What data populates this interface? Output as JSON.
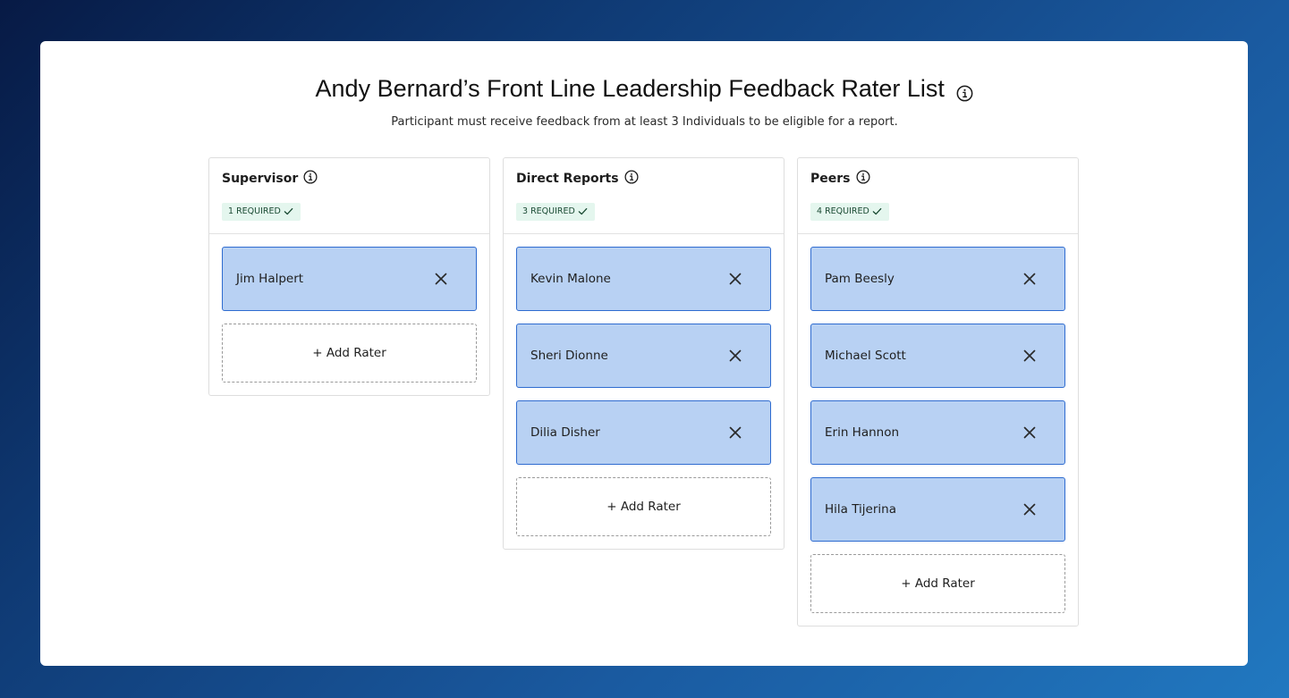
{
  "header": {
    "title": "Andy Bernard’s Front Line Leadership Feedback Rater List",
    "subtitle": "Participant must receive feedback from at least 3 Individuals to be eligible for a report."
  },
  "columns": [
    {
      "title": "Supervisor",
      "badge": "1 REQUIRED",
      "raters": [
        "Jim Halpert"
      ],
      "add_label": "+ Add Rater"
    },
    {
      "title": "Direct Reports",
      "badge": "3 REQUIRED",
      "raters": [
        "Kevin Malone",
        "Sheri Dionne",
        "Dilia Disher"
      ],
      "add_label": "+ Add Rater"
    },
    {
      "title": "Peers",
      "badge": "4 REQUIRED",
      "raters": [
        "Pam Beesly",
        "Michael Scott",
        "Erin Hannon",
        "Hila Tijerina"
      ],
      "add_label": "+ Add Rater"
    }
  ],
  "icons": {
    "info": "info-icon",
    "check": "check-icon",
    "remove": "close-icon"
  },
  "colors": {
    "rater_fill": "#b8d1f3",
    "rater_border": "#2f6cd0",
    "badge_bg": "#e4f6ee",
    "badge_text": "#1a4a33"
  }
}
